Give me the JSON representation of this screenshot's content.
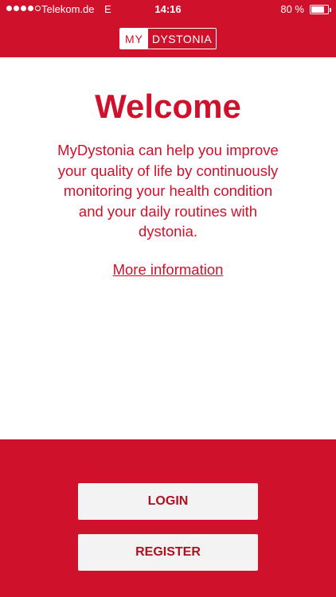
{
  "status_bar": {
    "carrier": "Telekom.de",
    "network": "E",
    "time": "14:16",
    "battery": "80 %",
    "battery_level": 0.8,
    "signal_bars_filled": 4,
    "signal_bars_total": 5
  },
  "header": {
    "logo_my": "MY",
    "logo_name": "DYSTONIA"
  },
  "main": {
    "title": "Welcome",
    "description": "MyDystonia can help you improve your quality of life by continuously monitoring your health condition and your daily routines with dystonia.",
    "more_info_link": "More information"
  },
  "actions": {
    "login_label": "LOGIN",
    "register_label": "REGISTER"
  },
  "colors": {
    "brand_red": "#d0112b",
    "button_bg": "#f3f3f3",
    "button_text": "#b0101f"
  }
}
